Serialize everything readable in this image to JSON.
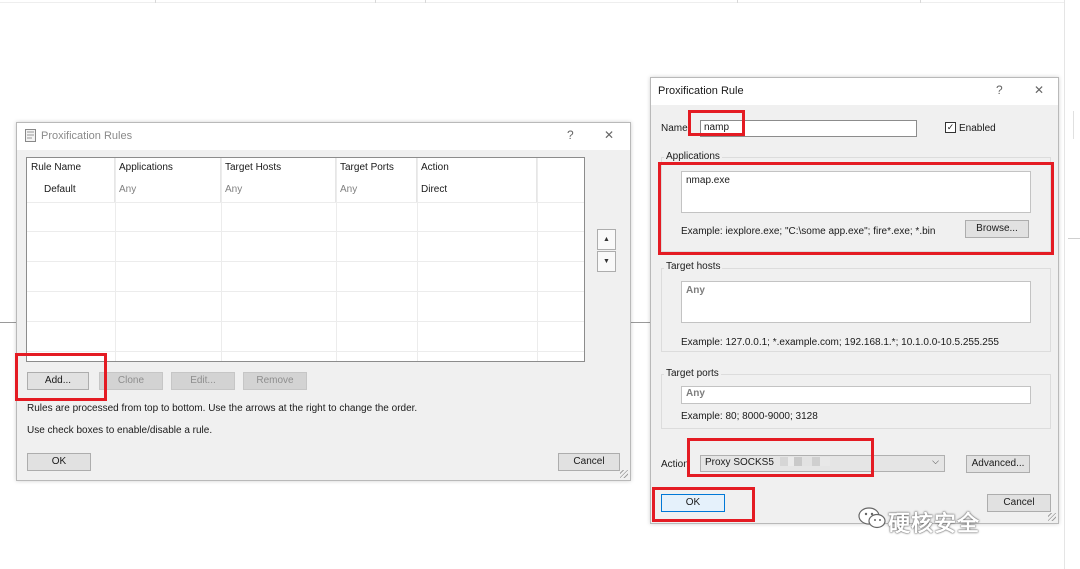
{
  "rules_window": {
    "title": "Proxification Rules",
    "help_glyph": "?",
    "close_glyph": "✕",
    "columns": [
      "Rule Name",
      "Applications",
      "Target Hosts",
      "Target Ports",
      "Action"
    ],
    "rows": [
      {
        "name": "Default",
        "applications": "Any",
        "target_hosts": "Any",
        "target_ports": "Any",
        "action": "Direct"
      }
    ],
    "move_up_glyph": "▲",
    "move_down_glyph": "▼",
    "buttons": {
      "add": "Add...",
      "clone": "Clone",
      "edit": "Edit...",
      "remove": "Remove",
      "ok": "OK",
      "cancel": "Cancel"
    },
    "info_order": "Rules are processed from top to bottom. Use the arrows at the right to change the order.",
    "info_checkboxes": "Use check boxes to enable/disable a rule."
  },
  "rule_window": {
    "title": "Proxification Rule",
    "help_glyph": "?",
    "close_glyph": "✕",
    "name_label": "Name:",
    "name_value": "namp",
    "enabled_label": "Enabled",
    "enabled_checked": true,
    "check_glyph": "✓",
    "applications": {
      "label": "Applications",
      "value": "nmap.exe",
      "example": "Example: iexplore.exe; \"C:\\some app.exe\"; fire*.exe; *.bin",
      "browse": "Browse..."
    },
    "target_hosts": {
      "label": "Target hosts",
      "value": "Any",
      "example": "Example: 127.0.0.1; *.example.com; 192.168.1.*; 10.1.0.0-10.5.255.255"
    },
    "target_ports": {
      "label": "Target ports",
      "value": "Any",
      "example": "Example: 80; 8000-9000; 3128"
    },
    "action_label": "Action",
    "action_value": "Proxy SOCKS5",
    "action_chevron": "⌵",
    "advanced": "Advanced...",
    "ok": "OK",
    "cancel": "Cancel"
  },
  "watermark": {
    "text": "硬核安全"
  },
  "colors": {
    "highlight": "#e41b23",
    "focus": "#0078d7",
    "window_bg": "#f0f0f0"
  }
}
